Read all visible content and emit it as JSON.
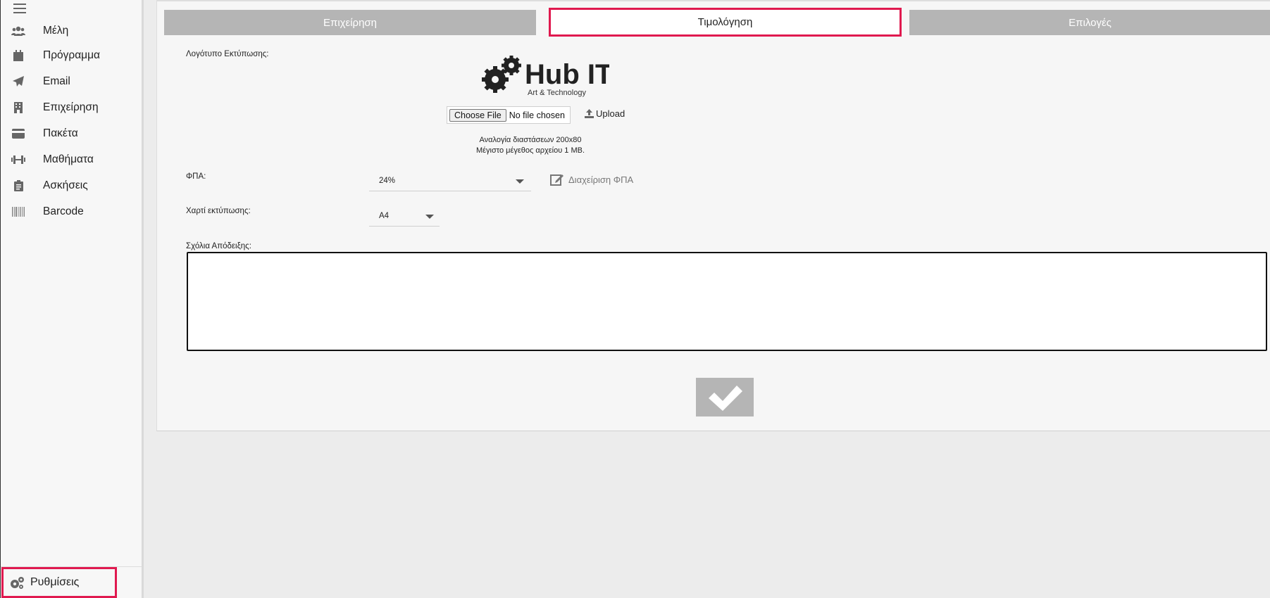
{
  "sidebar": {
    "items": [
      {
        "label": "Μέλη",
        "icon": "users-icon"
      },
      {
        "label": "Πρόγραμμα",
        "icon": "calendar-icon"
      },
      {
        "label": "Email",
        "icon": "paper-plane-icon"
      },
      {
        "label": "Επιχείρηση",
        "icon": "building-icon"
      },
      {
        "label": "Πακέτα",
        "icon": "credit-card-icon"
      },
      {
        "label": "Μαθήματα",
        "icon": "dumbbell-icon"
      },
      {
        "label": "Ασκήσεις",
        "icon": "clipboard-icon"
      },
      {
        "label": "Barcode",
        "icon": "barcode-icon"
      }
    ],
    "settings": {
      "label": "Ρυθμίσεις",
      "icon": "gears-icon"
    }
  },
  "tabs": [
    {
      "label": "Επιχείρηση"
    },
    {
      "label": "Τιμολόγηση",
      "active": true
    },
    {
      "label": "Επιλογές"
    }
  ],
  "form": {
    "logo_label": "Λογότυπο Εκτύπωσης:",
    "logo_text": "Hub IT",
    "logo_subtext": "Art & Technology",
    "choose_file": "Choose File",
    "no_file": "No file chosen",
    "upload": "Upload",
    "hint_ratio": "Αναλογία διαστάσεων 200x80",
    "hint_size": "Μέγιστο μέγεθος αρχείου 1 MB.",
    "vat_label": "ΦΠΑ:",
    "vat_value": "24%",
    "vat_manage": "Διαχείριση ΦΠΑ",
    "paper_label": "Χαρτί εκτύπωσης:",
    "paper_value": "A4",
    "comments_label": "Σχόλια Απόδειξης:",
    "comments_value": ""
  },
  "colors": {
    "accent": "#e0194f",
    "tab_inactive": "#b5b5b5"
  }
}
